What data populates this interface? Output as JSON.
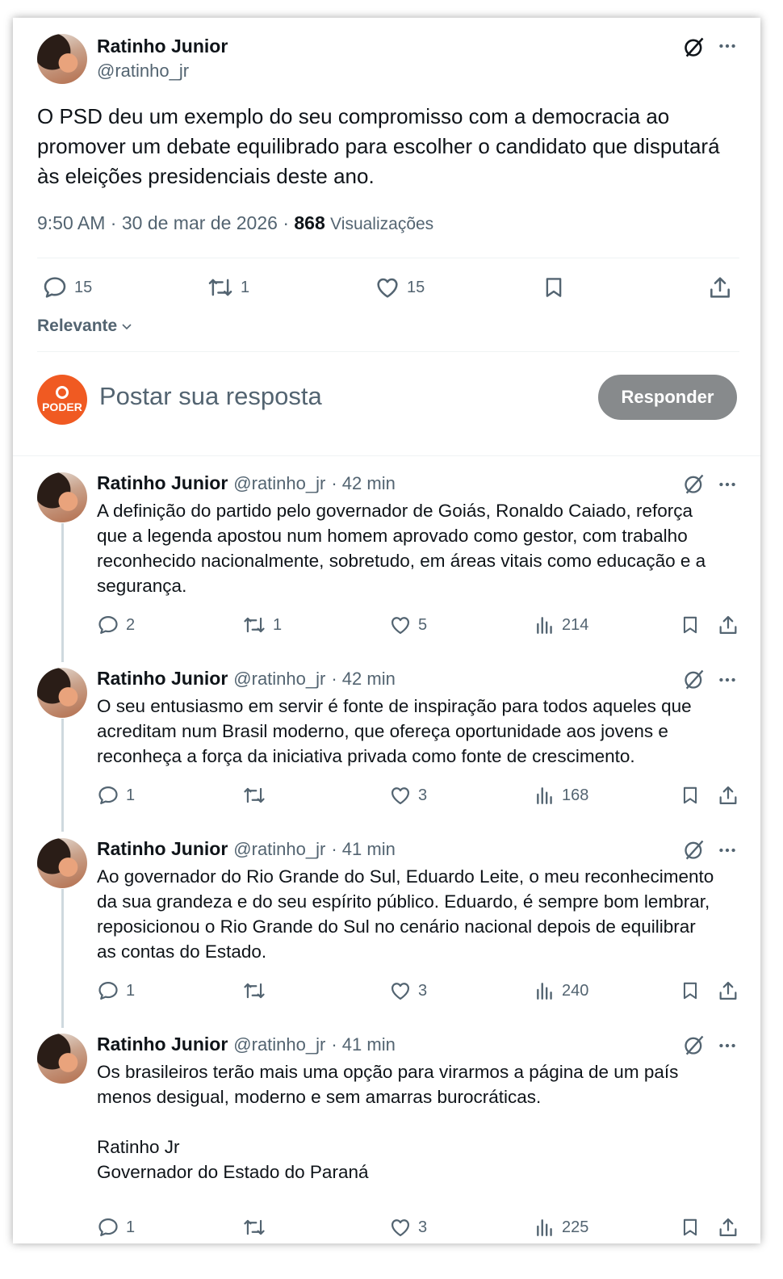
{
  "main_post": {
    "author_name": "Ratinho Junior",
    "author_handle": "@ratinho_jr",
    "text": "O PSD deu um exemplo do seu compromisso com a democracia ao promover um debate equilibrado para escolher o candidato que disputará às eleições presidenciais deste ano.",
    "time": "9:50 AM",
    "date": "30 de mar de 2026",
    "views_count": "868",
    "views_label": "Visualizações",
    "replies": "15",
    "reposts": "1",
    "likes": "15"
  },
  "sort_label": "Relevante",
  "composer": {
    "avatar_text": "PODER",
    "placeholder": "Postar sua resposta",
    "submit_label": "Responder"
  },
  "replies": [
    {
      "name": "Ratinho Junior",
      "handle": "@ratinho_jr",
      "time": "· 42 min",
      "lines": [
        "A definição do partido  pelo governador de Goiás, Ronaldo Caiado, reforça",
        "que a legenda apostou num homem aprovado como gestor,  com trabalho",
        "reconhecido nacionalmente, sobretudo, em áreas vitais como educação e a",
        "segurança."
      ],
      "replies": "2",
      "reposts": "1",
      "likes": "5",
      "views": "214"
    },
    {
      "name": "Ratinho Junior",
      "handle": "@ratinho_jr",
      "time": "· 42 min",
      "lines": [
        "O seu entusiasmo em servir é fonte de inspiração para todos aqueles que",
        "acreditam num Brasil moderno, que ofereça oportunidade aos jovens e",
        "reconheça a força da iniciativa privada como fonte de crescimento."
      ],
      "replies": "1",
      "reposts": "",
      "likes": "3",
      "views": "168"
    },
    {
      "name": "Ratinho Junior",
      "handle": "@ratinho_jr",
      "time": "· 41 min",
      "lines": [
        "Ao governador do Rio Grande do Sul, Eduardo Leite, o meu reconhecimento",
        "da sua grandeza e do seu espírito público. Eduardo, é sempre bom lembrar,",
        "reposicionou o Rio Grande do Sul no cenário nacional depois de equilibrar",
        "as contas do Estado."
      ],
      "replies": "1",
      "reposts": "",
      "likes": "3",
      "views": "240"
    },
    {
      "name": "Ratinho Junior",
      "handle": "@ratinho_jr",
      "time": "· 41 min",
      "lines": [
        "Os brasileiros terão mais uma opção para virarmos a página de um país",
        "menos desigual, moderno e sem amarras burocráticas.",
        "",
        "Ratinho Jr",
        "Governador do Estado do Paraná"
      ],
      "replies": "1",
      "reposts": "",
      "likes": "3",
      "views": "225"
    }
  ]
}
